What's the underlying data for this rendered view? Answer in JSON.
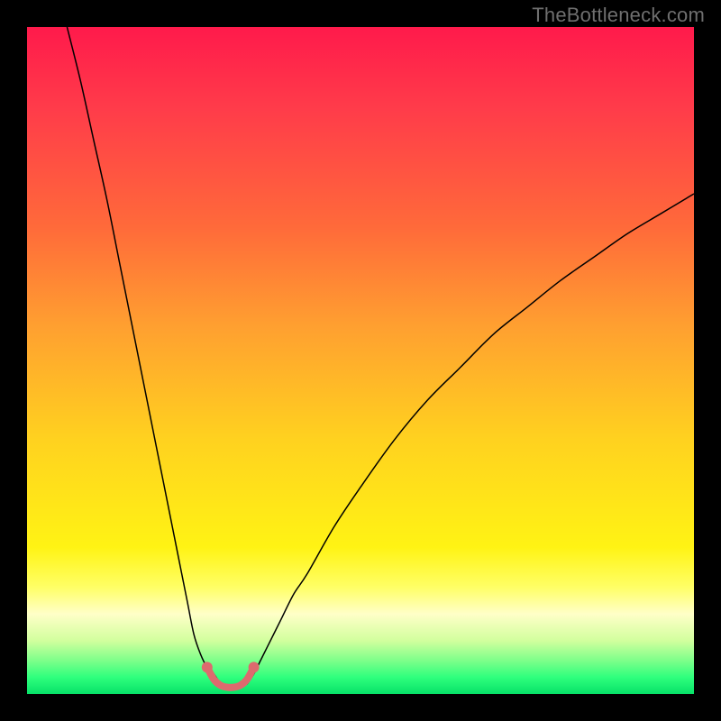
{
  "watermark": "TheBottleneck.com",
  "chart_data": {
    "type": "line",
    "title": "",
    "xlabel": "",
    "ylabel": "",
    "xlim": [
      0,
      100
    ],
    "ylim": [
      0,
      100
    ],
    "gradient_stops": [
      {
        "offset": 0.0,
        "color": "#ff1a4b"
      },
      {
        "offset": 0.12,
        "color": "#ff3b4a"
      },
      {
        "offset": 0.3,
        "color": "#ff6a3a"
      },
      {
        "offset": 0.45,
        "color": "#ffa030"
      },
      {
        "offset": 0.62,
        "color": "#ffd21f"
      },
      {
        "offset": 0.78,
        "color": "#fff314"
      },
      {
        "offset": 0.84,
        "color": "#ffff66"
      },
      {
        "offset": 0.88,
        "color": "#ffffc8"
      },
      {
        "offset": 0.92,
        "color": "#d2ff9e"
      },
      {
        "offset": 0.95,
        "color": "#7dff8a"
      },
      {
        "offset": 0.975,
        "color": "#2fff7d"
      },
      {
        "offset": 1.0,
        "color": "#07e268"
      }
    ],
    "series": [
      {
        "name": "left-curve",
        "stroke": "#000000",
        "stroke_width": 1.5,
        "x": [
          6,
          8,
          10,
          12,
          14,
          16,
          18,
          20,
          22,
          24,
          25,
          26,
          27,
          28,
          29
        ],
        "y": [
          100,
          92,
          83,
          74,
          64,
          54,
          44,
          34,
          24,
          14,
          9,
          6,
          4,
          3,
          1.5
        ]
      },
      {
        "name": "right-curve",
        "stroke": "#000000",
        "stroke_width": 1.5,
        "x": [
          33,
          34,
          35,
          36,
          38,
          40,
          42,
          46,
          50,
          55,
          60,
          65,
          70,
          75,
          80,
          85,
          90,
          95,
          100
        ],
        "y": [
          1.5,
          3,
          5,
          7,
          11,
          15,
          18,
          25,
          31,
          38,
          44,
          49,
          54,
          58,
          62,
          65.5,
          69,
          72,
          75
        ]
      },
      {
        "name": "bottom-highlight",
        "stroke": "#dd6a6e",
        "stroke_width": 8,
        "linecap": "round",
        "x": [
          27,
          28,
          29,
          30,
          31,
          32,
          33,
          34
        ],
        "y": [
          4,
          2.2,
          1.3,
          1.0,
          1.0,
          1.3,
          2.2,
          4
        ]
      },
      {
        "name": "bottom-highlight-endpoints",
        "type": "scatter",
        "color": "#dd6a6e",
        "marker_r": 6,
        "x": [
          27,
          34
        ],
        "y": [
          4,
          4
        ]
      }
    ]
  }
}
